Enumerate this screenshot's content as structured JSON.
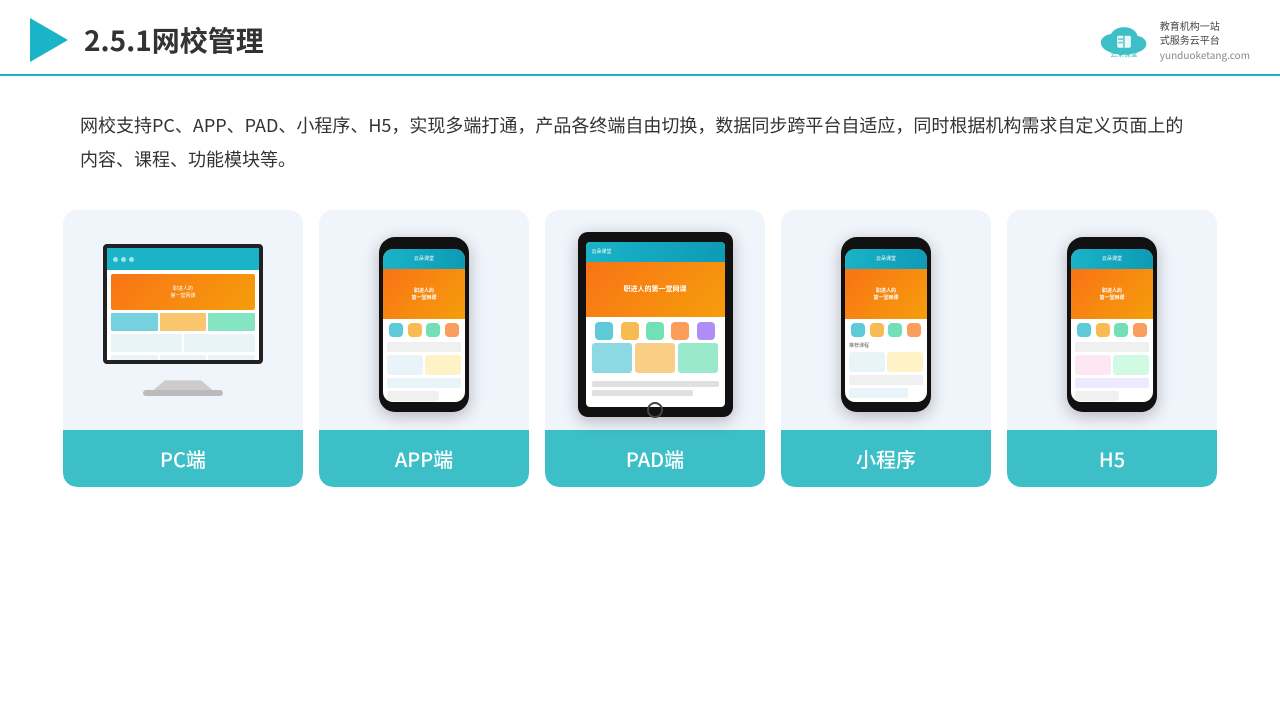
{
  "header": {
    "title_prefix": "2.5.1",
    "title_main": "网校管理"
  },
  "logo": {
    "brand": "云朵课堂",
    "domain": "yunduoketang.com",
    "tagline": "教育机构一站\n式服务云平台"
  },
  "description": "网校支持PC、APP、PAD、小程序、H5，实现多端打通，产品各终端自由切换，数据同步跨平台自适应，同时根据机构需求自定义页面上的内容、课程、功能模块等。",
  "cards": [
    {
      "id": "pc",
      "label": "PC端",
      "type": "pc"
    },
    {
      "id": "app",
      "label": "APP端",
      "type": "phone"
    },
    {
      "id": "pad",
      "label": "PAD端",
      "type": "tablet"
    },
    {
      "id": "miniapp",
      "label": "小程序",
      "type": "phone"
    },
    {
      "id": "h5",
      "label": "H5",
      "type": "phone"
    }
  ],
  "accent_color": "#3dbfc8"
}
